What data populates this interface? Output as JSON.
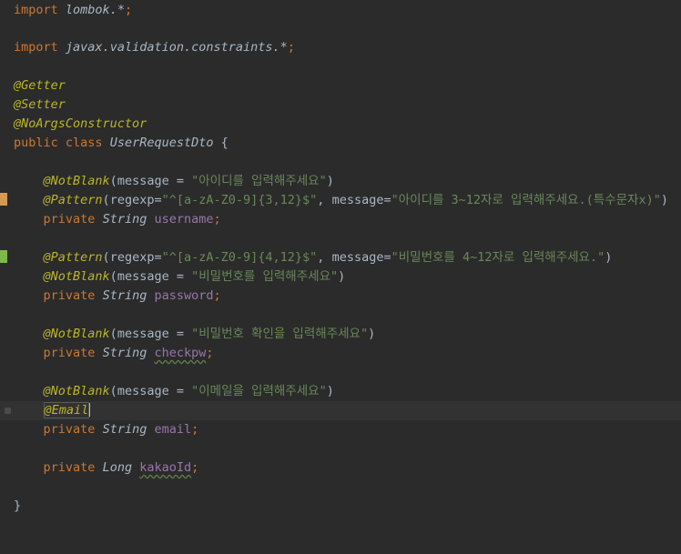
{
  "editor": {
    "lines": [
      {
        "k": "import",
        "p": "lombok.*",
        "s": ";"
      },
      {
        "k": "import",
        "p": "javax.validation.constraints.*",
        "s": ";"
      },
      {
        "a": "@Getter"
      },
      {
        "a": "@Setter"
      },
      {
        "a": "@NoArgsConstructor"
      },
      {
        "k1": "public",
        "k2": "class",
        "n": "UserRequestDto",
        "s": " {"
      },
      {
        "a": "@NotBlank",
        "open": "(",
        "key": "message",
        "eq": " = ",
        "sv": "\"아이디를 입력해주세요\"",
        "close": ")"
      },
      {
        "a": "@Pattern",
        "open": "(",
        "key": "regexp",
        "eq": "=",
        "sv": "\"^[a-zA-Z0-9]{3,12}$\"",
        "comma": ", ",
        "key2": "message",
        "eq2": "=",
        "sv2": "\"아이디를 3~12자로 입력해주세요.(특수문자x)\"",
        "close": ")"
      },
      {
        "k": "private",
        "t": "String",
        "f": "username",
        "s": ";"
      },
      {
        "a": "@Pattern",
        "open": "(",
        "key": "regexp",
        "eq": "=",
        "sv": "\"^[a-zA-Z0-9]{4,12}$\"",
        "comma": ", ",
        "key2": "message",
        "eq2": "=",
        "sv2": "\"비밀번호를 4~12자로 입력해주세요.\"",
        "close": ")"
      },
      {
        "a": "@NotBlank",
        "open": "(",
        "key": "message",
        "eq": " = ",
        "sv": "\"비밀번호를 입력해주세요\"",
        "close": ")"
      },
      {
        "k": "private",
        "t": "String",
        "f": "password",
        "s": ";"
      },
      {
        "a": "@NotBlank",
        "open": "(",
        "key": "message",
        "eq": " = ",
        "sv": "\"비밀번호 확인을 입력해주세요\"",
        "close": ")"
      },
      {
        "k": "private",
        "t": "String",
        "f": "checkpw",
        "s": ";"
      },
      {
        "a": "@NotBlank",
        "open": "(",
        "key": "message",
        "eq": " = ",
        "sv": "\"이메일을 입력해주세요\"",
        "close": ")"
      },
      {
        "a": "@Email"
      },
      {
        "k": "private",
        "t": "String",
        "f": "email",
        "s": ";"
      },
      {
        "k": "private",
        "t": "Long",
        "f": "kakaoId",
        "s": ";"
      },
      {
        "s": "}"
      }
    ]
  }
}
